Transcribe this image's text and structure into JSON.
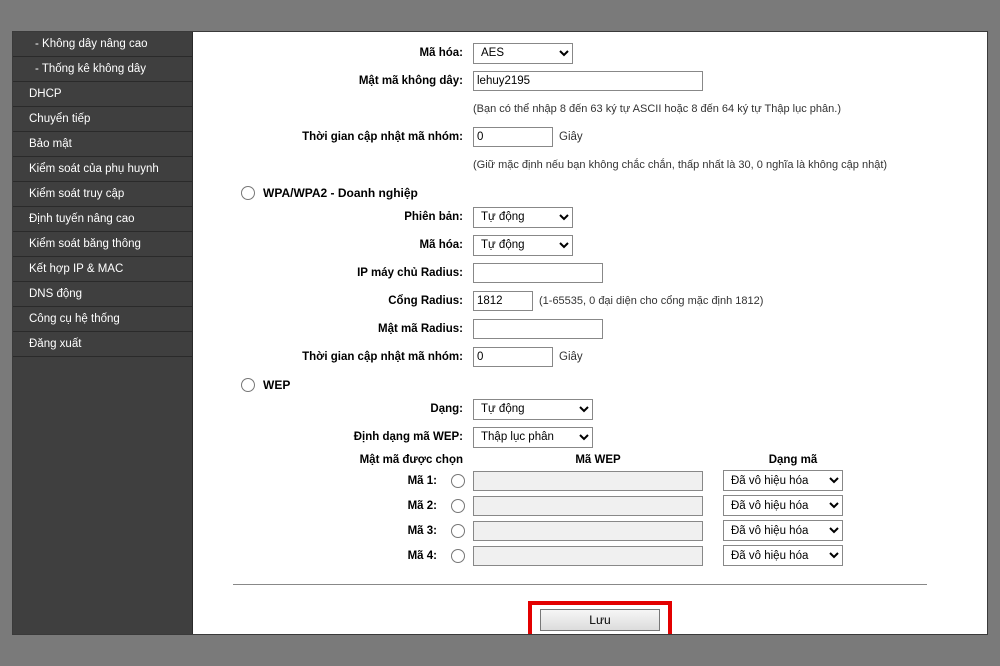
{
  "sidebar": {
    "items": [
      {
        "label": "- Không dây nâng cao",
        "sub": true
      },
      {
        "label": "- Thống kê không dây",
        "sub": true
      },
      {
        "label": "DHCP",
        "sub": false
      },
      {
        "label": "Chuyển tiếp",
        "sub": false
      },
      {
        "label": "Bảo mật",
        "sub": false
      },
      {
        "label": "Kiểm soát của phụ huynh",
        "sub": false
      },
      {
        "label": "Kiểm soát truy cập",
        "sub": false
      },
      {
        "label": "Định tuyến nâng cao",
        "sub": false
      },
      {
        "label": "Kiểm soát băng thông",
        "sub": false
      },
      {
        "label": "Kết hợp IP & MAC",
        "sub": false
      },
      {
        "label": "DNS động",
        "sub": false
      },
      {
        "label": "Công cụ hệ thống",
        "sub": false
      },
      {
        "label": "Đăng xuất",
        "sub": false
      }
    ]
  },
  "wpa_personal": {
    "encryption_label": "Mã hóa:",
    "encryption_value": "AES",
    "password_label": "Mật mã không dây:",
    "password_value": "lehuy2195",
    "password_hint": "(Bạn có thể nhập 8 đến 63 ký tự ASCII hoặc 8 đến 64 ký tự Thập lục phân.)",
    "gku_label": "Thời gian cập nhật mã nhóm:",
    "gku_value": "0",
    "gku_unit": "Giây",
    "gku_hint": "(Giữ mặc định nếu bạn không chắc chắn, thấp nhất là 30, 0 nghĩa là không cập nhật)"
  },
  "wpa_ent": {
    "section_label": "WPA/WPA2 - Doanh nghiệp",
    "version_label": "Phiên bản:",
    "version_value": "Tự động",
    "encryption_label": "Mã hóa:",
    "encryption_value": "Tự động",
    "radius_ip_label": "IP máy chủ Radius:",
    "radius_ip_value": "",
    "radius_port_label": "Cổng Radius:",
    "radius_port_value": "1812",
    "radius_port_hint": "(1-65535, 0 đại diện cho cổng mặc định 1812)",
    "radius_pw_label": "Mật mã Radius:",
    "radius_pw_value": "",
    "gku_label": "Thời gian cập nhật mã nhóm:",
    "gku_value": "0",
    "gku_unit": "Giây"
  },
  "wep": {
    "section_label": "WEP",
    "type_label": "Dạng:",
    "type_value": "Tự động",
    "format_label": "Định dạng mã WEP:",
    "format_value": "Thập lục phân",
    "header_selected": "Mật mã được chọn",
    "header_key": "Mã WEP",
    "header_type": "Dạng mã",
    "keys": [
      {
        "label": "Mã 1:",
        "value": "",
        "type": "Đã vô hiệu hóa"
      },
      {
        "label": "Mã 2:",
        "value": "",
        "type": "Đã vô hiệu hóa"
      },
      {
        "label": "Mã 3:",
        "value": "",
        "type": "Đã vô hiệu hóa"
      },
      {
        "label": "Mã 4:",
        "value": "",
        "type": "Đã vô hiệu hóa"
      }
    ]
  },
  "save_label": "Lưu"
}
